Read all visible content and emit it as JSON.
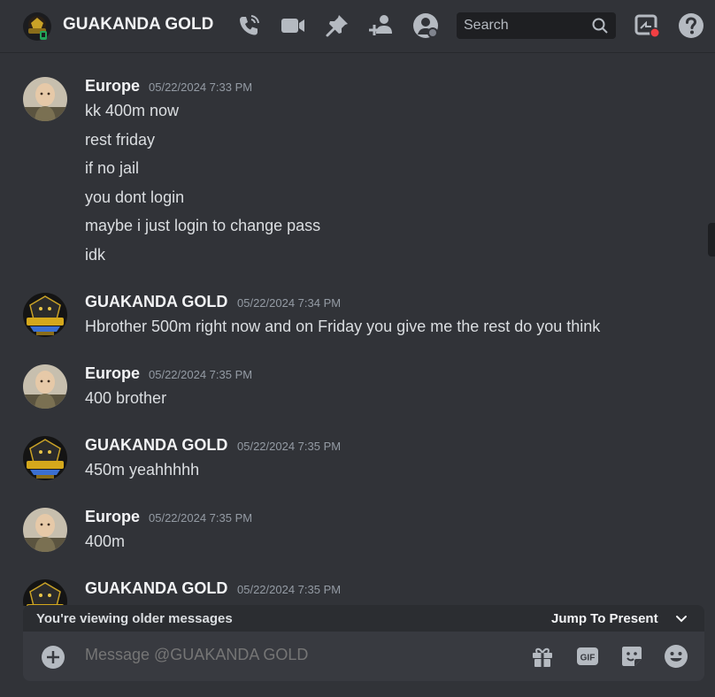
{
  "header": {
    "title": "GUAKANDA GOLD",
    "icons": [
      "phone-call-icon",
      "video-camera-icon",
      "pin-icon",
      "add-friend-icon",
      "user-profile-icon",
      "search-icon",
      "inbox-icon",
      "help-icon"
    ],
    "search_placeholder": "Search"
  },
  "messages": [
    {
      "author": "Europe",
      "avatar": "europe-avatar",
      "timestamp": "05/22/2024 7:33 PM",
      "lines": [
        "kk 400m now",
        "rest friday",
        "if no jail",
        "you dont login",
        "maybe i just login to change pass",
        "idk"
      ]
    },
    {
      "author": "GUAKANDA GOLD",
      "avatar": "guakanda-avatar",
      "timestamp": "05/22/2024 7:34 PM",
      "lines": [
        "Hbrother 500m right now and on Friday you give me the rest do you think"
      ]
    },
    {
      "author": "Europe",
      "avatar": "europe-avatar",
      "timestamp": "05/22/2024 7:35 PM",
      "lines": [
        "400 brother"
      ]
    },
    {
      "author": "GUAKANDA GOLD",
      "avatar": "guakanda-avatar",
      "timestamp": "05/22/2024 7:35 PM",
      "lines": [
        "450m yeahhhhh"
      ]
    },
    {
      "author": "Europe",
      "avatar": "europe-avatar",
      "timestamp": "05/22/2024 7:35 PM",
      "lines": [
        "400m"
      ]
    },
    {
      "author": "GUAKANDA GOLD",
      "avatar": "guakanda-avatar",
      "timestamp": "05/22/2024 7:35 PM",
      "lines": []
    }
  ],
  "older_bar": {
    "text": "You're viewing older messages",
    "jump": "Jump To Present"
  },
  "composer": {
    "placeholder": "Message @GUAKANDA GOLD",
    "gif_label": "GIF",
    "icons": [
      "add-attachment-icon",
      "gift-icon",
      "gif-icon",
      "sticker-icon",
      "emoji-icon"
    ]
  },
  "colors": {
    "background": "#313338",
    "composer": "#383a40",
    "status_dnd": "#f23f43"
  }
}
